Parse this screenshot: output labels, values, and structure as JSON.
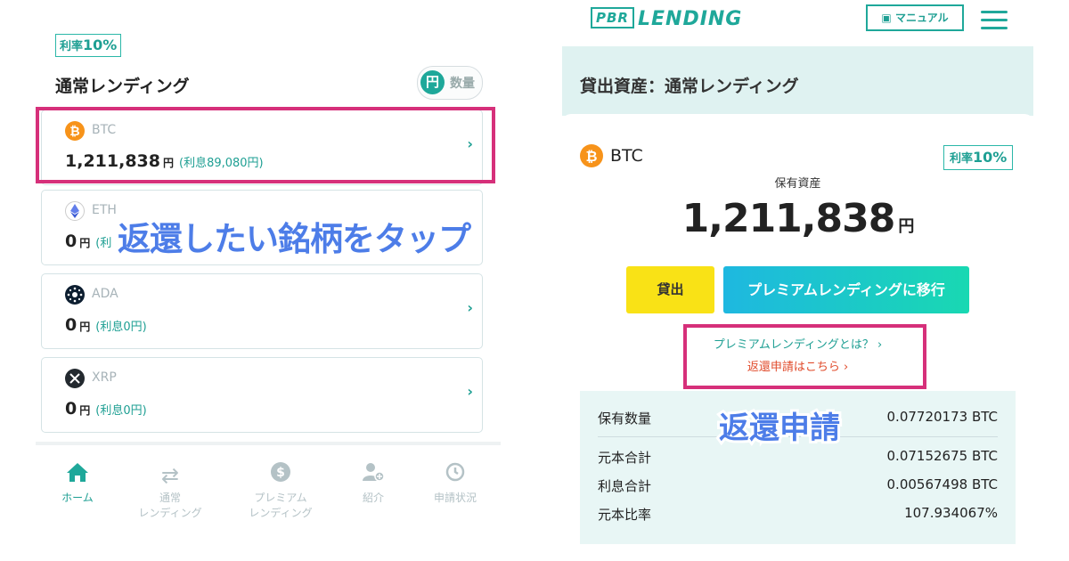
{
  "left": {
    "rate_badge_prefix": "利率",
    "rate_badge_value": "10%",
    "section_title": "通常レンディング",
    "toggle_yen": "円",
    "toggle_qty": "数量",
    "cards": [
      {
        "coin": "BTC",
        "amount": "1,211,838",
        "yen": "円",
        "interest": "(利息89,080円)",
        "color": "#f7931a"
      },
      {
        "coin": "ETH",
        "amount": "0",
        "yen": "円",
        "interest": "(利",
        "color": "#627eea"
      },
      {
        "coin": "ADA",
        "amount": "0",
        "yen": "円",
        "interest": "(利息0円)",
        "color": "#0d1e30"
      },
      {
        "coin": "XRP",
        "amount": "0",
        "yen": "円",
        "interest": "(利息0円)",
        "color": "#23292f"
      }
    ],
    "nav": {
      "home": "ホーム",
      "normal_1": "通常",
      "normal_2": "レンディング",
      "premium_1": "プレミアム",
      "premium_2": "レンディング",
      "referral": "紹介",
      "status": "申請状況"
    },
    "overlay": "返還したい銘柄をタップ"
  },
  "right": {
    "logo_pbr": "PBR",
    "logo_text": "LENDING",
    "manual": "マニュアル",
    "band_title": "貸出資産：通常レンディング",
    "coin": "BTC",
    "rate_badge_prefix": "利率",
    "rate_badge_value": "10%",
    "holding_label": "保有資産",
    "holding_amount": "1,211,838",
    "holding_yen": "円",
    "btn_lend": "貸出",
    "btn_premium": "プレミアムレンディングに移行",
    "link_premium": "プレミアムレンディングとは？ ›",
    "link_return": "返還申請はこちら ›",
    "stats": [
      {
        "label": "保有数量",
        "value": "0.07720173 BTC"
      },
      {
        "label": "元本合計",
        "value": "0.07152675 BTC"
      },
      {
        "label": "利息合計",
        "value": "0.00567498 BTC"
      },
      {
        "label": "元本比率",
        "value": "107.934067%"
      }
    ],
    "overlay": "返還申請"
  },
  "colors": {
    "accent": "#1fa89a",
    "highlight": "#d6307a",
    "overlay": "#4d7de8"
  }
}
